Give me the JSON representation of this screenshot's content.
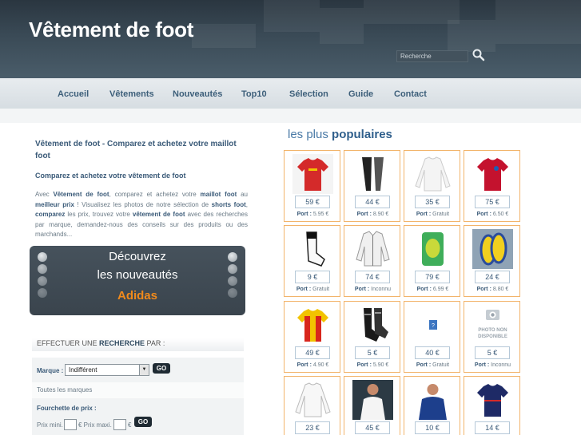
{
  "header": {
    "site_title": "Vêtement de foot",
    "search_placeholder": "Recherche"
  },
  "nav": [
    "Accueil",
    "Vêtements",
    "Nouveautés",
    "Top10",
    "Sélection",
    "Guide",
    "Contact"
  ],
  "intro": {
    "title": "Vêtement de foot - Comparez et achetez votre maillot foot",
    "subtitle": "Comparez et achetez votre vêtement de foot",
    "desc_parts": [
      {
        "t": "Avec ",
        "b": false
      },
      {
        "t": "Vêtement de foot",
        "b": true
      },
      {
        "t": ", comparez et achetez votre ",
        "b": false
      },
      {
        "t": "maillot foot",
        "b": true
      },
      {
        "t": " au ",
        "b": false
      },
      {
        "t": "meilleur prix",
        "b": true
      },
      {
        "t": " ! Visualisez les photos de notre sélection de ",
        "b": false
      },
      {
        "t": "shorts foot",
        "b": true
      },
      {
        "t": ", ",
        "b": false
      },
      {
        "t": "comparez",
        "b": true
      },
      {
        "t": " les prix, trouvez votre ",
        "b": false
      },
      {
        "t": "vêtement de foot",
        "b": true
      },
      {
        "t": " avec des recherches par marque, demandez-nous des conseils sur des produits ou des marchands...",
        "b": false
      }
    ]
  },
  "promo": {
    "line1": "Découvrez",
    "line2": "les nouveautés",
    "brand": "Adidas"
  },
  "search_panel": {
    "title_prefix": "EFFECTUER UNE ",
    "title_bold": "RECHERCHE",
    "title_suffix": " PAR :",
    "marque_label": "Marque :",
    "marque_value": "Indifférent",
    "go": "GO",
    "all_brands": "Toutes les marques",
    "price_range_label": "Fourchette de prix :",
    "prix_mini": "Prix mini.",
    "prix_maxi": "€ Prix maxi.",
    "euro": "€"
  },
  "popular": {
    "title_light": "les plus ",
    "title_bold": "populaires",
    "port_label": "Port :",
    "products": [
      {
        "price": "59 €",
        "port": "5.95 €",
        "img": "red-jersey"
      },
      {
        "price": "44 €",
        "port": "8.90 €",
        "img": "black-pants"
      },
      {
        "price": "35 €",
        "port": "Gratuit",
        "img": "white-longsleeve"
      },
      {
        "price": "75 €",
        "port": "6.50 €",
        "img": "bayern-jersey"
      },
      {
        "price": "9 €",
        "port": "Gratuit",
        "img": "socks"
      },
      {
        "price": "74 €",
        "port": "Inconnu",
        "img": "white-jacket"
      },
      {
        "price": "79 €",
        "port": "6.99 €",
        "img": "goalie-glove-pack"
      },
      {
        "price": "24 €",
        "port": "8.80 €",
        "img": "shin-guards"
      },
      {
        "price": "49 €",
        "port": "4.90 €",
        "img": "yellow-red-jersey"
      },
      {
        "price": "5 €",
        "port": "5.90 €",
        "img": "black-socks"
      },
      {
        "price": "40 €",
        "port": "Gratuit",
        "img": "missing-image"
      },
      {
        "price": "5 €",
        "port": "Inconnu",
        "img": "photo-non-disponible"
      },
      {
        "price": "23 €",
        "port": "",
        "img": "white-shirt"
      },
      {
        "price": "45 €",
        "port": "",
        "img": "player-white"
      },
      {
        "price": "10 €",
        "port": "",
        "img": "player-blue"
      },
      {
        "price": "14 €",
        "port": "",
        "img": "navy-jersey"
      }
    ],
    "no_photo_text": "PHOTO NON DISPONIBLE"
  },
  "colors": {
    "accent": "#3a5a78",
    "card_border": "#f2b46b",
    "promo_brand": "#f08a1c"
  }
}
